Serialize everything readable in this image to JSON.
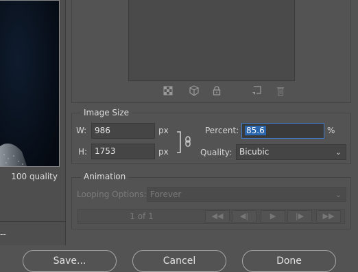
{
  "preview": {
    "quality_label": "100 quality",
    "bottom_text": "--"
  },
  "color_table_icons": [
    "web-snap-icon",
    "cube-icon",
    "lock-icon",
    "new-color-icon",
    "trash-icon"
  ],
  "image_size": {
    "title": "Image Size",
    "width_label": "W:",
    "width_value": "986",
    "width_unit": "px",
    "height_label": "H:",
    "height_value": "1753",
    "height_unit": "px",
    "percent_label": "Percent:",
    "percent_value": "85.6",
    "percent_unit": "%",
    "quality_label": "Quality:",
    "quality_value": "Bicubic"
  },
  "animation": {
    "title": "Animation",
    "looping_label": "Looping Options:",
    "looping_value": "Forever",
    "frame_counter": "1 of 1"
  },
  "buttons": {
    "save": "Save...",
    "cancel": "Cancel",
    "done": "Done"
  },
  "colors": {
    "background": "#535353",
    "accent": "#2966ad",
    "selection_border": "#3e7cc8"
  }
}
